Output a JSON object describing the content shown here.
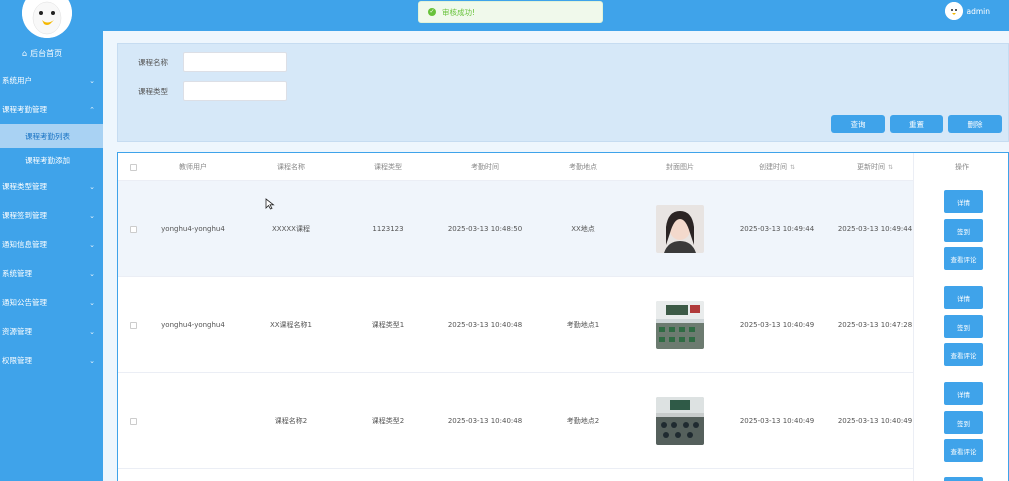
{
  "sidebar": {
    "home_label": "后台首页",
    "items": [
      {
        "label": "系统用户",
        "expanded": false
      },
      {
        "label": "课程考勤管理",
        "expanded": true,
        "children": [
          {
            "label": "课程考勤列表",
            "active": true
          },
          {
            "label": "课程考勤添加",
            "active": false
          }
        ]
      },
      {
        "label": "课程类型管理",
        "expanded": false
      },
      {
        "label": "课程签到管理",
        "expanded": false
      },
      {
        "label": "通知信息管理",
        "expanded": false
      },
      {
        "label": "系统管理",
        "expanded": false
      },
      {
        "label": "通知公告管理",
        "expanded": false
      },
      {
        "label": "资源管理",
        "expanded": false
      },
      {
        "label": "权限管理",
        "expanded": false
      }
    ]
  },
  "header": {
    "username": "admin"
  },
  "toast": {
    "message": "审核成功!"
  },
  "search": {
    "fields": [
      {
        "label": "课程名称",
        "value": ""
      },
      {
        "label": "课程类型",
        "value": ""
      }
    ],
    "buttons": {
      "query": "查询",
      "reset": "重置",
      "delete": "删除"
    }
  },
  "table": {
    "columns": [
      "教师用户",
      "课程名称",
      "课程类型",
      "考勤时间",
      "考勤地点",
      "封面图片",
      "创建时间",
      "更新时间",
      "操作"
    ],
    "rows": [
      {
        "teacher": "yonghu4-yonghu4",
        "course": "XXXXX课程",
        "type": "1123123",
        "time": "2025-03-13 10:48:50",
        "place": "XX地点",
        "cover": "portrait",
        "created": "2025-03-13 10:49:44",
        "updated": "2025-03-13 10:49:44"
      },
      {
        "teacher": "yonghu4-yonghu4",
        "course": "XX课程名称1",
        "type": "课程类型1",
        "time": "2025-03-13 10:40:48",
        "place": "考勤地点1",
        "cover": "classroom",
        "created": "2025-03-13 10:40:49",
        "updated": "2025-03-13 10:47:28"
      },
      {
        "teacher": "",
        "course": "课程名称2",
        "type": "课程类型2",
        "time": "2025-03-13 10:40:48",
        "place": "考勤地点2",
        "cover": "classroom",
        "created": "2025-03-13 10:40:49",
        "updated": "2025-03-13 10:40:49"
      }
    ],
    "actions": {
      "detail": "详情",
      "signin": "签到",
      "comments": "查看评论"
    }
  },
  "colors": {
    "primary": "#3fa3ea",
    "success": "#67c23a",
    "active_sub_bg": "#a9d2f3"
  }
}
